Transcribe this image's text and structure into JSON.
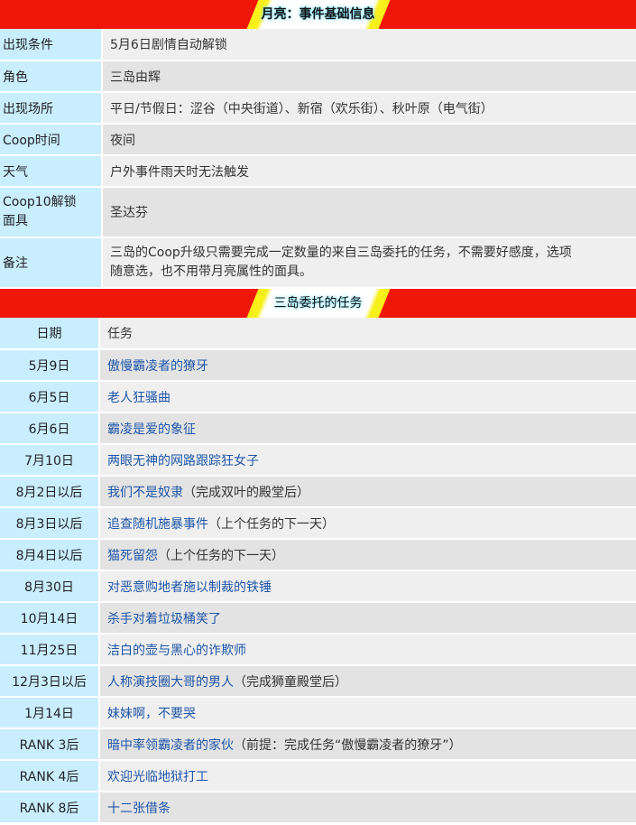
{
  "section1_title": "月亮：事件基础信息",
  "info_rows": [
    {
      "key": "出现条件",
      "value": "5月6日剧情自动解锁"
    },
    {
      "key": "角色",
      "value": "三岛由辉"
    },
    {
      "key": "出现场所",
      "value": "平日/节假日：涩谷（中央街道）、新宿（欢乐街）、秋叶原（电气街）"
    },
    {
      "key": "Coop时间",
      "value": "夜间"
    },
    {
      "key": "天气",
      "value": "户外事件雨天时无法触发"
    },
    {
      "key_line1": "Coop10解锁",
      "key_line2": "面具",
      "value": "圣达芬"
    },
    {
      "key": "备注",
      "value_line1": "三岛的Coop升级只需要完成一定数量的来自三岛委托的任务，不需要好感度，选项",
      "value_line2": "随意选，也不用带月亮属性的面具。"
    }
  ],
  "section2_title": "三岛委托的任务",
  "tasks_header": {
    "date": "日期",
    "task": "任务"
  },
  "tasks": [
    {
      "date": "5月9日",
      "task": "傲慢霸凌者的獠牙",
      "note": ""
    },
    {
      "date": "6月5日",
      "task": "老人狂骚曲",
      "note": ""
    },
    {
      "date": "6月6日",
      "task": "霸凌是爱的象征",
      "note": ""
    },
    {
      "date": "7月10日",
      "task": "两眼无神的网路跟踪狂女子",
      "note": ""
    },
    {
      "date": "8月2日以后",
      "task": "我们不是奴隶",
      "note": "（完成双叶的殿堂后）"
    },
    {
      "date": "8月3日以后",
      "task": "追查随机施暴事件",
      "note": "（上个任务的下一天）"
    },
    {
      "date": "8月4日以后",
      "task": "猫死留怨",
      "note": "（上个任务的下一天）"
    },
    {
      "date": "8月30日",
      "task": "对恶意购地者施以制裁的铁锤",
      "note": ""
    },
    {
      "date": "10月14日",
      "task": "杀手对着垃圾桶笑了",
      "note": ""
    },
    {
      "date": "11月25日",
      "task": "洁白的壶与黑心的诈欺师",
      "note": ""
    },
    {
      "date": "12月3日以后",
      "task": "人称演技圈大哥的男人",
      "note": "（完成狮童殿堂后）"
    },
    {
      "date": "1月14日",
      "task": "妹妹啊，不要哭",
      "note": ""
    },
    {
      "date": "RANK 3后",
      "task": "暗中率领霸凌者的家伙",
      "note": "（前提：完成任务“傲慢霸凌者的獠牙”）"
    },
    {
      "date": "RANK 4后",
      "task": "欢迎光临地狱打工",
      "note": ""
    },
    {
      "date": "RANK 8后",
      "task": "十二张借条",
      "note": ""
    }
  ]
}
